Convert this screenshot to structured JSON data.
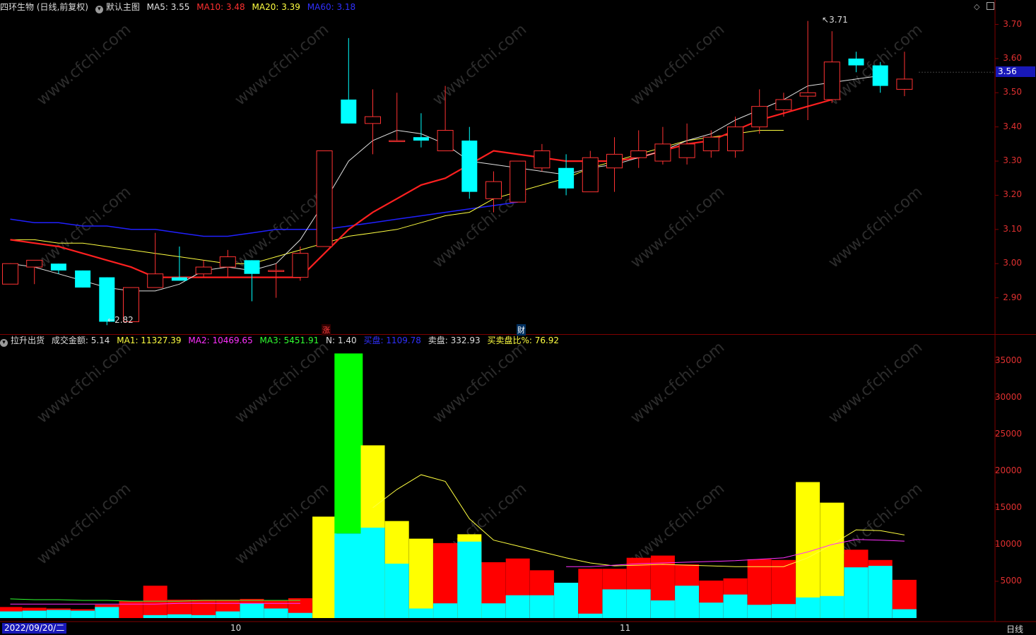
{
  "top_header": {
    "title": "四环生物 (日线,前复权)",
    "indicator_name": "默认主图",
    "ma5": "MA5: 3.55",
    "ma10": "MA10: 3.48",
    "ma20": "MA20: 3.39",
    "ma60": "MA60: 3.18"
  },
  "vol_header": {
    "indicator_name": "拉升出货",
    "amount": "成交金额: 5.14",
    "ma1": "MA1: 11327.39",
    "ma2": "MA2: 10469.65",
    "ma3": "MA3: 5451.91",
    "n": "N: 1.40",
    "buy": "买盘: 1109.78",
    "sell": "卖盘: 332.93",
    "ratio": "买卖盘比%: 76.92"
  },
  "price_axis": [
    "3.70",
    "3.60",
    "3.50",
    "3.40",
    "3.30",
    "3.20",
    "3.10",
    "3.00",
    "2.90"
  ],
  "volume_axis": [
    "35000",
    "30000",
    "25000",
    "20000",
    "15000",
    "10000",
    "5000"
  ],
  "current_price": "3.56",
  "high_label": "3.71",
  "low_label": "2.82",
  "markers": {
    "zhang": "涨",
    "cai": "财"
  },
  "bottom": {
    "date": "2022/09/20/二",
    "month_10": "10",
    "month_11": "11",
    "period": "日线"
  },
  "watermark": "www.cfchi.com",
  "colors": {
    "up": "#ff3232",
    "down": "#00ffff",
    "ma5": "#e0e0e0",
    "ma10": "#ff2020",
    "ma20": "#ffff40",
    "ma60": "#2020ff",
    "axis": "#800000"
  },
  "chart_data": {
    "type": "candlestick",
    "candles": [
      {
        "o": 2.94,
        "c": 3.0,
        "h": 3.0,
        "l": 2.94
      },
      {
        "o": 2.99,
        "c": 3.01,
        "h": 3.01,
        "l": 2.94
      },
      {
        "o": 3.0,
        "c": 2.98,
        "h": 3.0,
        "l": 2.97
      },
      {
        "o": 2.98,
        "c": 2.93,
        "h": 2.98,
        "l": 2.93
      },
      {
        "o": 2.96,
        "c": 2.83,
        "h": 2.96,
        "l": 2.82
      },
      {
        "o": 2.83,
        "c": 2.93,
        "h": 2.93,
        "l": 2.83
      },
      {
        "o": 2.93,
        "c": 2.97,
        "h": 3.09,
        "l": 2.93
      },
      {
        "o": 2.96,
        "c": 2.95,
        "h": 3.05,
        "l": 2.95
      },
      {
        "o": 2.97,
        "c": 2.99,
        "h": 3.01,
        "l": 2.96
      },
      {
        "o": 2.99,
        "c": 3.02,
        "h": 3.04,
        "l": 2.96
      },
      {
        "o": 3.01,
        "c": 2.97,
        "h": 3.01,
        "l": 2.89
      },
      {
        "o": 2.98,
        "c": 2.98,
        "h": 3.0,
        "l": 2.9
      },
      {
        "o": 2.96,
        "c": 3.03,
        "h": 3.05,
        "l": 2.95
      },
      {
        "o": 3.05,
        "c": 3.33,
        "h": 3.33,
        "l": 3.05
      },
      {
        "o": 3.48,
        "c": 3.41,
        "h": 3.66,
        "l": 3.41
      },
      {
        "o": 3.41,
        "c": 3.43,
        "h": 3.51,
        "l": 3.32
      },
      {
        "o": 3.36,
        "c": 3.36,
        "h": 3.5,
        "l": 3.36
      },
      {
        "o": 3.37,
        "c": 3.36,
        "h": 3.44,
        "l": 3.34
      },
      {
        "o": 3.33,
        "c": 3.39,
        "h": 3.52,
        "l": 3.33
      },
      {
        "o": 3.36,
        "c": 3.21,
        "h": 3.4,
        "l": 3.19
      },
      {
        "o": 3.19,
        "c": 3.24,
        "h": 3.27,
        "l": 3.15
      },
      {
        "o": 3.18,
        "c": 3.3,
        "h": 3.3,
        "l": 3.18
      },
      {
        "o": 3.28,
        "c": 3.33,
        "h": 3.35,
        "l": 3.27
      },
      {
        "o": 3.28,
        "c": 3.22,
        "h": 3.32,
        "l": 3.2
      },
      {
        "o": 3.21,
        "c": 3.31,
        "h": 3.33,
        "l": 3.21
      },
      {
        "o": 3.28,
        "c": 3.32,
        "h": 3.37,
        "l": 3.21
      },
      {
        "o": 3.31,
        "c": 3.33,
        "h": 3.39,
        "l": 3.28
      },
      {
        "o": 3.3,
        "c": 3.35,
        "h": 3.4,
        "l": 3.29
      },
      {
        "o": 3.31,
        "c": 3.35,
        "h": 3.41,
        "l": 3.29
      },
      {
        "o": 3.33,
        "c": 3.37,
        "h": 3.39,
        "l": 3.31
      },
      {
        "o": 3.33,
        "c": 3.4,
        "h": 3.43,
        "l": 3.31
      },
      {
        "o": 3.4,
        "c": 3.46,
        "h": 3.51,
        "l": 3.38
      },
      {
        "o": 3.45,
        "c": 3.48,
        "h": 3.5,
        "l": 3.43
      },
      {
        "o": 3.49,
        "c": 3.5,
        "h": 3.71,
        "l": 3.42
      },
      {
        "o": 3.48,
        "c": 3.59,
        "h": 3.68,
        "l": 3.47
      },
      {
        "o": 3.6,
        "c": 3.58,
        "h": 3.62,
        "l": 3.56
      },
      {
        "o": 3.58,
        "c": 3.52,
        "h": 3.59,
        "l": 3.5
      },
      {
        "o": 3.51,
        "c": 3.54,
        "h": 3.62,
        "l": 3.49
      }
    ],
    "ma5": [
      3.0,
      2.99,
      2.97,
      2.95,
      2.93,
      2.92,
      2.92,
      2.94,
      2.98,
      2.99,
      2.98,
      3.0,
      3.07,
      3.18,
      3.3,
      3.36,
      3.39,
      3.38,
      3.35,
      3.3,
      3.29,
      3.28,
      3.27,
      3.26,
      3.28,
      3.29,
      3.31,
      3.33,
      3.36,
      3.38,
      3.42,
      3.45,
      3.48,
      3.52,
      3.53,
      3.54,
      3.55
    ],
    "ma10": [
      3.07,
      3.06,
      3.05,
      3.03,
      3.01,
      2.99,
      2.96,
      2.96,
      2.96,
      2.96,
      2.96,
      2.96,
      2.96,
      3.03,
      3.1,
      3.15,
      3.19,
      3.23,
      3.25,
      3.29,
      3.33,
      3.32,
      3.31,
      3.3,
      3.3,
      3.3,
      3.31,
      3.33,
      3.35,
      3.36,
      3.39,
      3.42,
      3.44,
      3.46,
      3.48
    ],
    "ma20": [
      3.07,
      3.07,
      3.06,
      3.06,
      3.05,
      3.04,
      3.03,
      3.02,
      3.01,
      3.0,
      3.0,
      3.02,
      3.04,
      3.06,
      3.08,
      3.09,
      3.1,
      3.12,
      3.14,
      3.15,
      3.19,
      3.21,
      3.23,
      3.25,
      3.28,
      3.3,
      3.32,
      3.34,
      3.36,
      3.37,
      3.38,
      3.39,
      3.39
    ],
    "ma60": [
      3.13,
      3.12,
      3.12,
      3.11,
      3.11,
      3.1,
      3.1,
      3.09,
      3.08,
      3.08,
      3.09,
      3.1,
      3.1,
      3.1,
      3.11,
      3.12,
      3.13,
      3.14,
      3.15,
      3.16,
      3.17,
      3.18
    ],
    "volume": [
      {
        "total": 1500,
        "buy": 900,
        "kind": "red"
      },
      {
        "total": 1400,
        "buy": 1000,
        "kind": "red"
      },
      {
        "total": 1300,
        "buy": 1100,
        "kind": "red"
      },
      {
        "total": 1200,
        "buy": 1000,
        "kind": "red"
      },
      {
        "total": 1800,
        "buy": 1500,
        "kind": "red"
      },
      {
        "total": 2300,
        "buy": 0,
        "kind": "red"
      },
      {
        "total": 4400,
        "buy": 400,
        "kind": "red"
      },
      {
        "total": 2500,
        "buy": 500,
        "kind": "red"
      },
      {
        "total": 2500,
        "buy": 400,
        "kind": "red"
      },
      {
        "total": 2500,
        "buy": 900,
        "kind": "red"
      },
      {
        "total": 2600,
        "buy": 2000,
        "kind": "red"
      },
      {
        "total": 2400,
        "buy": 1300,
        "kind": "red"
      },
      {
        "total": 2700,
        "buy": 700,
        "kind": "red"
      },
      {
        "total": 13800,
        "buy": 0,
        "kind": "yellow"
      },
      {
        "total": 36000,
        "buy": 11500,
        "kind": "green"
      },
      {
        "total": 23500,
        "buy": 12300,
        "kind": "yellow"
      },
      {
        "total": 13200,
        "buy": 7400,
        "kind": "yellow"
      },
      {
        "total": 10800,
        "buy": 1300,
        "kind": "yellow"
      },
      {
        "total": 10200,
        "buy": 2000,
        "kind": "red"
      },
      {
        "total": 11400,
        "buy": 10400,
        "kind": "yellow"
      },
      {
        "total": 7600,
        "buy": 2000,
        "kind": "red"
      },
      {
        "total": 8100,
        "buy": 3100,
        "kind": "red"
      },
      {
        "total": 6500,
        "buy": 3100,
        "kind": "red"
      },
      {
        "total": 4800,
        "buy": 4800,
        "kind": "red"
      },
      {
        "total": 6700,
        "buy": 600,
        "kind": "red"
      },
      {
        "total": 6700,
        "buy": 3900,
        "kind": "red"
      },
      {
        "total": 8200,
        "buy": 3900,
        "kind": "red"
      },
      {
        "total": 8500,
        "buy": 2400,
        "kind": "red"
      },
      {
        "total": 7300,
        "buy": 4400,
        "kind": "red"
      },
      {
        "total": 5100,
        "buy": 2100,
        "kind": "red"
      },
      {
        "total": 5400,
        "buy": 3200,
        "kind": "red"
      },
      {
        "total": 8000,
        "buy": 1800,
        "kind": "red"
      },
      {
        "total": 7900,
        "buy": 1900,
        "kind": "red"
      },
      {
        "total": 18500,
        "buy": 2800,
        "kind": "yellow"
      },
      {
        "total": 15700,
        "buy": 3000,
        "kind": "yellow"
      },
      {
        "total": 9300,
        "buy": 6900,
        "kind": "red"
      },
      {
        "total": 7900,
        "buy": 7100,
        "kind": "red"
      },
      {
        "total": 5200,
        "buy": 1200,
        "kind": "red"
      }
    ],
    "vol_ma1": [
      null,
      null,
      null,
      null,
      null,
      null,
      null,
      null,
      null,
      null,
      null,
      null,
      null,
      null,
      null,
      15000,
      17500,
      19500,
      18600,
      13500,
      10600,
      9800,
      9000,
      8200,
      7500,
      7100,
      7200,
      7300,
      7200,
      7100,
      7000,
      7000,
      7000,
      8200,
      10000,
      12000,
      11900,
      11300
    ],
    "vol_ma2": [
      1900,
      1900,
      1900,
      1900,
      1900,
      1900,
      1900,
      2000,
      2000,
      2000,
      2000,
      2000,
      2000,
      null,
      null,
      null,
      null,
      null,
      null,
      null,
      null,
      null,
      null,
      7000,
      7000,
      7200,
      7400,
      7500,
      7600,
      7700,
      7800,
      8000,
      8200,
      9000,
      10000,
      10700,
      10600,
      10470
    ],
    "vol_ma3": [
      2600,
      2500,
      2500,
      2400,
      2400,
      2300,
      2300,
      2300,
      2400,
      2400,
      2400,
      2400,
      2400
    ],
    "price_range": [
      2.8,
      3.73
    ],
    "volume_range": [
      0,
      37000
    ]
  }
}
